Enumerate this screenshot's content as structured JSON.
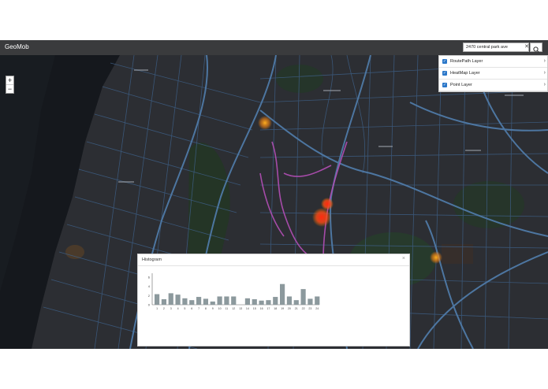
{
  "app": {
    "title": "GeoMob"
  },
  "search": {
    "value": "2470 central park ave"
  },
  "zoom": {
    "in_label": "+",
    "out_label": "−"
  },
  "layers": [
    {
      "label": "RoutePath Layer",
      "checked": true
    },
    {
      "label": "HeatMap Layer",
      "checked": true
    },
    {
      "label": "Point Layer",
      "checked": true
    }
  ],
  "histogram": {
    "title": "Histogram",
    "close_label": "×"
  },
  "colors": {
    "topbar": "#3a3b3d",
    "map_bg": "#2c2e33",
    "road": "#4c6f96",
    "route": "#b44fb6",
    "heat": "#ff3d1f",
    "bar": "#8c999d"
  },
  "chart_data": {
    "type": "bar",
    "categories": [
      "1",
      "2",
      "3",
      "4",
      "5",
      "6",
      "7",
      "8",
      "9",
      "10",
      "11",
      "12",
      "13",
      "14",
      "15",
      "16",
      "17",
      "18",
      "19",
      "20",
      "21",
      "22",
      "23",
      "24"
    ],
    "values": [
      2.3,
      1.2,
      2.5,
      2.2,
      1.4,
      1.0,
      1.7,
      1.3,
      0.7,
      1.8,
      1.8,
      1.8,
      0.0,
      1.4,
      1.2,
      0.9,
      1.0,
      1.7,
      4.5,
      1.8,
      1.0,
      3.4,
      1.3,
      1.8
    ],
    "yticks": [
      "0",
      "2",
      "4",
      "6"
    ],
    "ylim": [
      0,
      6.5
    ]
  }
}
